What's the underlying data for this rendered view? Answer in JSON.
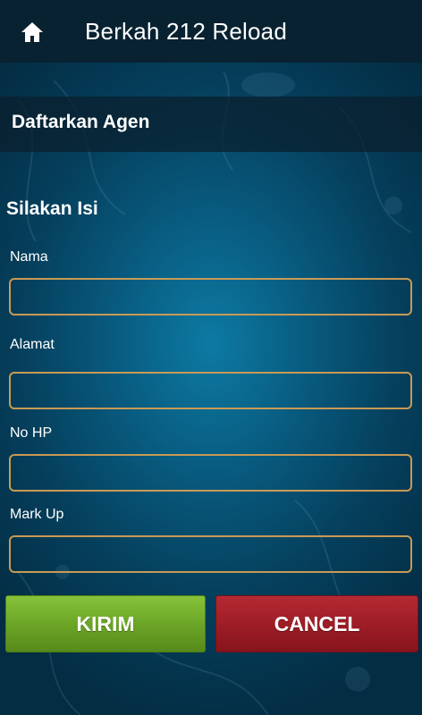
{
  "appbar": {
    "title": "Berkah 212 Reload",
    "home_icon": "home-icon"
  },
  "section": {
    "title": "Daftarkan Agen"
  },
  "form": {
    "heading": "Silakan Isi",
    "fields": [
      {
        "label": "Nama",
        "value": "",
        "placeholder": ""
      },
      {
        "label": "Alamat",
        "value": "",
        "placeholder": ""
      },
      {
        "label": "No HP",
        "value": "",
        "placeholder": ""
      },
      {
        "label": "Mark Up",
        "value": "",
        "placeholder": ""
      }
    ]
  },
  "buttons": {
    "submit_label": "KIRIM",
    "cancel_label": "CANCEL"
  },
  "colors": {
    "appbar": "#082231",
    "input_border": "#c89a55",
    "submit": "#6aa325",
    "cancel": "#9c1c25"
  }
}
